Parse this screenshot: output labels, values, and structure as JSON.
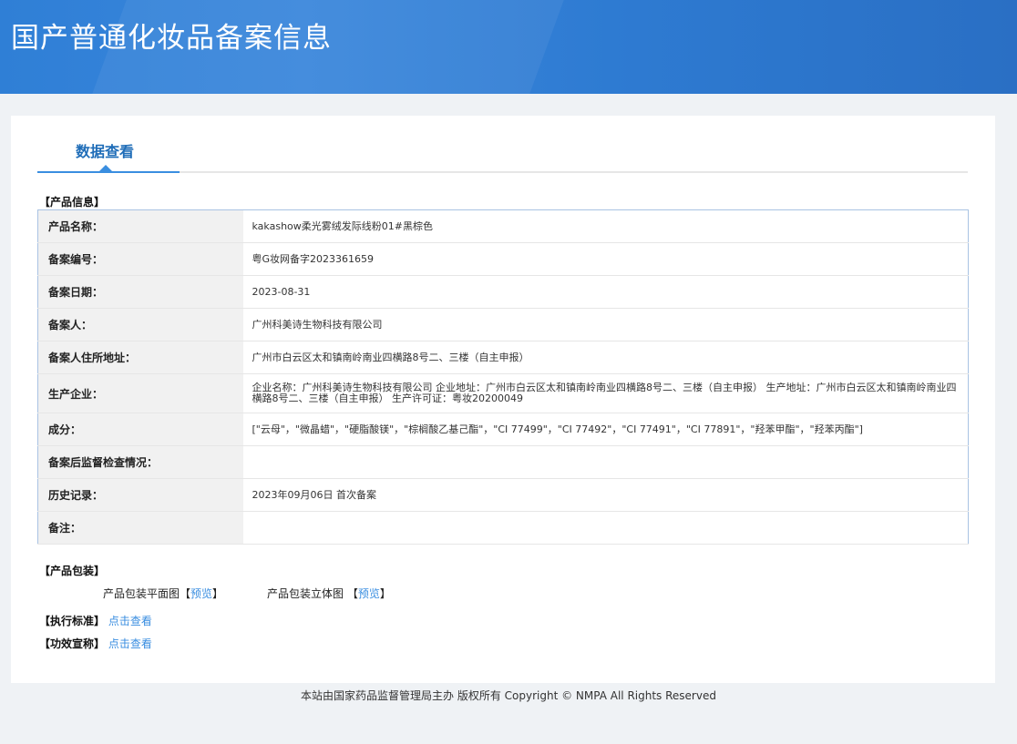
{
  "header": {
    "title": "国产普通化妆品备案信息"
  },
  "tab": {
    "label": "数据查看"
  },
  "product_info": {
    "heading": "【产品信息】",
    "rows": [
      {
        "label": "产品名称：",
        "value": "kakashow柔光雾绒发际线粉01#黑棕色"
      },
      {
        "label": "备案编号：",
        "value": "粤G妆网备字2023361659"
      },
      {
        "label": "备案日期：",
        "value": "2023-08-31"
      },
      {
        "label": "备案人：",
        "value": "广州科美诗生物科技有限公司"
      },
      {
        "label": "备案人住所地址：",
        "value": "广州市白云区太和镇南岭南业四横路8号二、三楼（自主申报）"
      },
      {
        "label": "生产企业：",
        "value": "企业名称：广州科美诗生物科技有限公司 企业地址：广州市白云区太和镇南岭南业四横路8号二、三楼（自主申报） 生产地址：广州市白云区太和镇南岭南业四横路8号二、三楼（自主申报） 生产许可证：粤妆20200049"
      },
      {
        "label": "成分：",
        "value": "[\"云母\"，\"微晶蜡\"，\"硬脂酸镁\"，\"棕榈酸乙基己酯\"，\"CI 77499\"，\"CI 77492\"，\"CI 77491\"，\"CI 77891\"，\"羟苯甲酯\"，\"羟苯丙酯\"]"
      },
      {
        "label": "备案后监督检查情况：",
        "value": ""
      },
      {
        "label": "历史记录：",
        "value": "2023年09月06日 首次备案"
      },
      {
        "label": "备注：",
        "value": ""
      }
    ]
  },
  "packaging": {
    "heading": "【产品包装】",
    "flat_label": "产品包装平面图",
    "stereo_label": "产品包装立体图",
    "open": "【",
    "close": "】",
    "preview": "预览"
  },
  "standard": {
    "label": "【执行标准】",
    "link": "点击查看"
  },
  "claim": {
    "label": "【功效宣称】",
    "link": "点击查看"
  },
  "footer": {
    "text": "本站由国家药品监督管理局主办 版权所有 Copyright © NMPA All Rights Reserved"
  }
}
